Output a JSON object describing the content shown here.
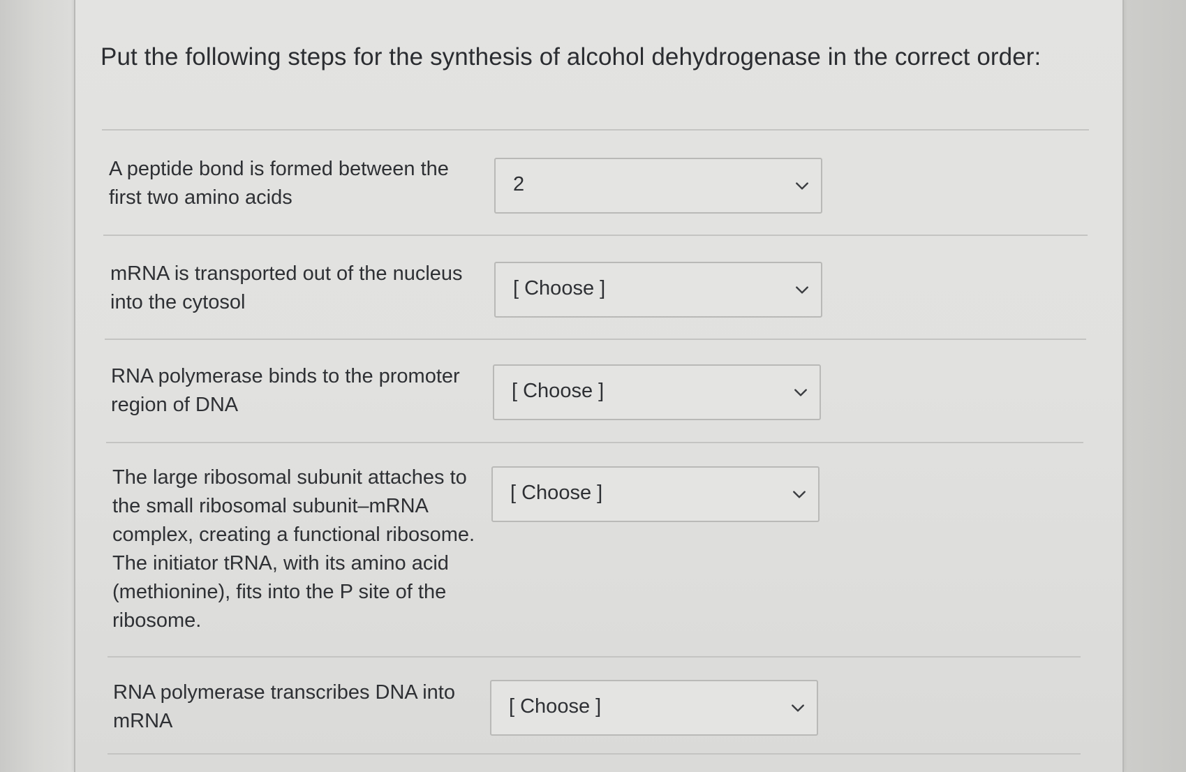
{
  "question": {
    "prompt": "Put the following steps for the synthesis of alcohol dehydrogenase in the correct order:"
  },
  "steps": [
    {
      "label": "A peptide bond is formed between the\nfirst two amino acids",
      "selected": "2"
    },
    {
      "label": "mRNA is transported out of the nucleus\ninto the cytosol",
      "selected": "[ Choose ]"
    },
    {
      "label": "RNA polymerase binds to the promoter\nregion of DNA",
      "selected": "[ Choose ]"
    },
    {
      "label": "The large ribosomal subunit attaches to\nthe small ribosomal subunit–mRNA\ncomplex, creating a functional ribosome.\nThe initiator tRNA, with its amino acid\n(methionine), fits into the P site of the\nribosome.",
      "selected": "[ Choose ]"
    },
    {
      "label": "RNA polymerase transcribes DNA into\nmRNA",
      "selected": "[ Choose ]"
    }
  ],
  "icons": {
    "dropdown": "chevron-down-icon"
  }
}
